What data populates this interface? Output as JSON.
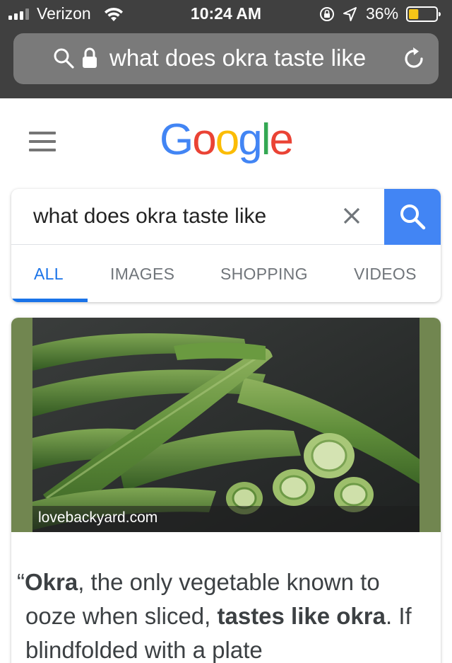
{
  "status_bar": {
    "carrier": "Verizon",
    "time": "10:24 AM",
    "battery_percent": "36%",
    "battery_level": 0.36,
    "icons": [
      "signal-icon",
      "wifi-icon",
      "rotation-lock-icon",
      "location-arrow-icon",
      "battery-icon"
    ]
  },
  "address_bar": {
    "text": "what does okra taste like",
    "icons": [
      "search-icon",
      "lock-icon",
      "reload-icon"
    ]
  },
  "header": {
    "logo": "Google",
    "logo_colors": [
      "#4285F4",
      "#EA4335",
      "#FBBC05",
      "#4285F4",
      "#34A853",
      "#EA4335"
    ]
  },
  "search": {
    "query": "what does okra taste like",
    "accent": "#4285f4"
  },
  "tabs": [
    {
      "label": "ALL",
      "active": true
    },
    {
      "label": "IMAGES",
      "active": false
    },
    {
      "label": "SHOPPING",
      "active": false
    },
    {
      "label": "VIDEOS",
      "active": false
    }
  ],
  "result": {
    "image_source": "lovebackyard.com",
    "snippet": {
      "open_quote": "“",
      "bold1": "Okra",
      "text1": ", the only vegetable known to ooze when sliced, ",
      "bold2": "tastes like okra",
      "text2": ". If blindfolded with a plate"
    }
  }
}
